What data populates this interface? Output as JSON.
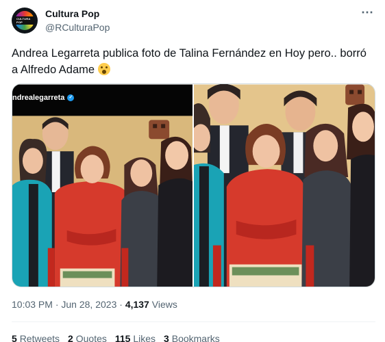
{
  "author": {
    "name": "Cultura Pop",
    "handle": "@RCulturaPop",
    "avatar_text": "CULTURA POP"
  },
  "more_icon": "⋯",
  "tweet_text": "Andrea Legarreta publica foto de Talina Fernández en Hoy pero.. borró a Alfredo Adame",
  "media": {
    "left_overlay_username": "ndrealegarreta"
  },
  "meta": {
    "time": "10:03 PM",
    "separator": "·",
    "date": "Jun 28, 2023",
    "views_count": "4,137",
    "views_label": "Views"
  },
  "stats": [
    {
      "count": "5",
      "label": "Retweets"
    },
    {
      "count": "2",
      "label": "Quotes"
    },
    {
      "count": "115",
      "label": "Likes"
    },
    {
      "count": "3",
      "label": "Bookmarks"
    }
  ],
  "colors": {
    "verified": "#1d9bf0",
    "secondary_text": "#536471"
  }
}
